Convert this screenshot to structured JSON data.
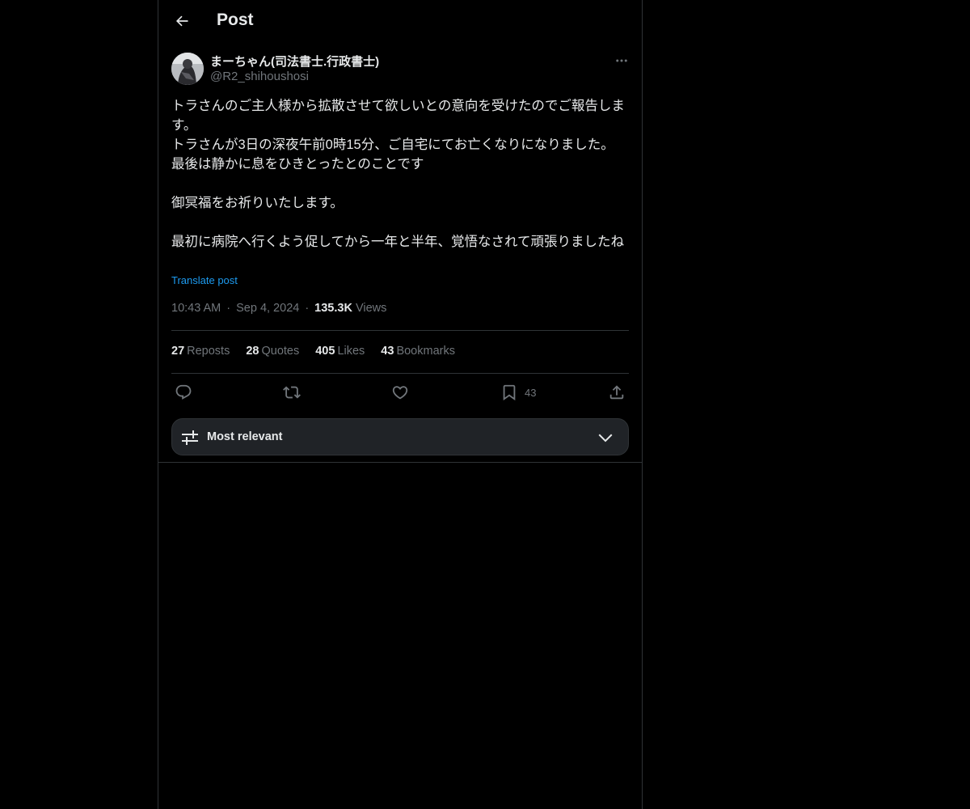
{
  "header": {
    "title": "Post"
  },
  "author": {
    "name": "まーちゃん(司法書士.行政書士)",
    "handle": "@R2_shihoushosi"
  },
  "post": {
    "text": "トラさんのご主人様から拡散させて欲しいとの意向を受けたのでご報告します。\nトラさんが3日の深夜午前0時15分、ご自宅にてお亡くなりになりました。\n最後は静かに息をひきとったとのことです\n\n御冥福をお祈りいたします。\n\n最初に病院へ行くよう促してから一年と半年、覚悟なされて頑張りましたね",
    "translate_label": "Translate post",
    "time": "10:43 AM",
    "date": "Sep 4, 2024",
    "views_count": "135.3K",
    "views_label": "Views"
  },
  "stats": {
    "reposts_count": "27",
    "reposts_label": "Reposts",
    "quotes_count": "28",
    "quotes_label": "Quotes",
    "likes_count": "405",
    "likes_label": "Likes",
    "bookmarks_count": "43",
    "bookmarks_label": "Bookmarks"
  },
  "actions": {
    "reply": "reply-icon",
    "repost": "repost-icon",
    "like": "heart-icon",
    "bookmark": "bookmark-icon",
    "bookmark_count": "43",
    "share": "share-icon"
  },
  "sort": {
    "label": "Most relevant"
  },
  "colors": {
    "background": "#000000",
    "text": "#e7e9ea",
    "secondary": "#71767b",
    "accent": "#1d9bf0",
    "border": "#2f3336"
  }
}
